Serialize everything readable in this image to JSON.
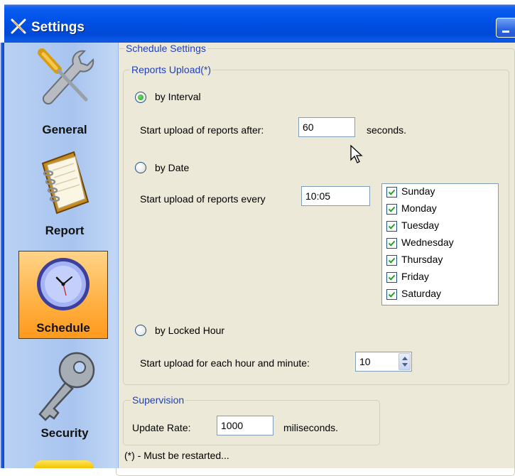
{
  "window": {
    "title": "Settings"
  },
  "sidebar": {
    "items": [
      {
        "label": "General",
        "icon": "tools-icon",
        "selected": false
      },
      {
        "label": "Report",
        "icon": "notebook-icon",
        "selected": false
      },
      {
        "label": "Schedule",
        "icon": "clock-icon",
        "selected": true
      },
      {
        "label": "Security",
        "icon": "key-icon",
        "selected": false
      }
    ]
  },
  "schedule": {
    "section_title": "Schedule Settings",
    "reports_upload": {
      "legend": "Reports Upload(*)",
      "interval": {
        "label": "by Interval",
        "checked": true,
        "prefix": "Start upload of reports after:",
        "value": "60",
        "suffix": "seconds."
      },
      "date": {
        "label": "by Date",
        "checked": false,
        "prefix": "Start upload of reports every",
        "value": "10:05",
        "days": [
          {
            "label": "Sunday",
            "checked": true
          },
          {
            "label": "Monday",
            "checked": true
          },
          {
            "label": "Tuesday",
            "checked": true
          },
          {
            "label": "Wednesday",
            "checked": true
          },
          {
            "label": "Thursday",
            "checked": true
          },
          {
            "label": "Friday",
            "checked": true
          },
          {
            "label": "Saturday",
            "checked": true
          }
        ]
      },
      "locked_hour": {
        "label": "by Locked Hour",
        "checked": false,
        "prefix": "Start upload for each hour and minute:",
        "value": "10"
      }
    },
    "supervision": {
      "legend": "Supervision",
      "prefix": "Update Rate:",
      "value": "1000",
      "suffix": "miliseconds."
    },
    "footnote": "(*) - Must be restarted..."
  },
  "colors": {
    "titlebar": "#0050e6",
    "sidebar": "#a8c4ef",
    "selected_item": "#ffb347",
    "group_legend": "#1f3fbf",
    "checkmark": "#21a121",
    "panel": "#ece9d8"
  }
}
